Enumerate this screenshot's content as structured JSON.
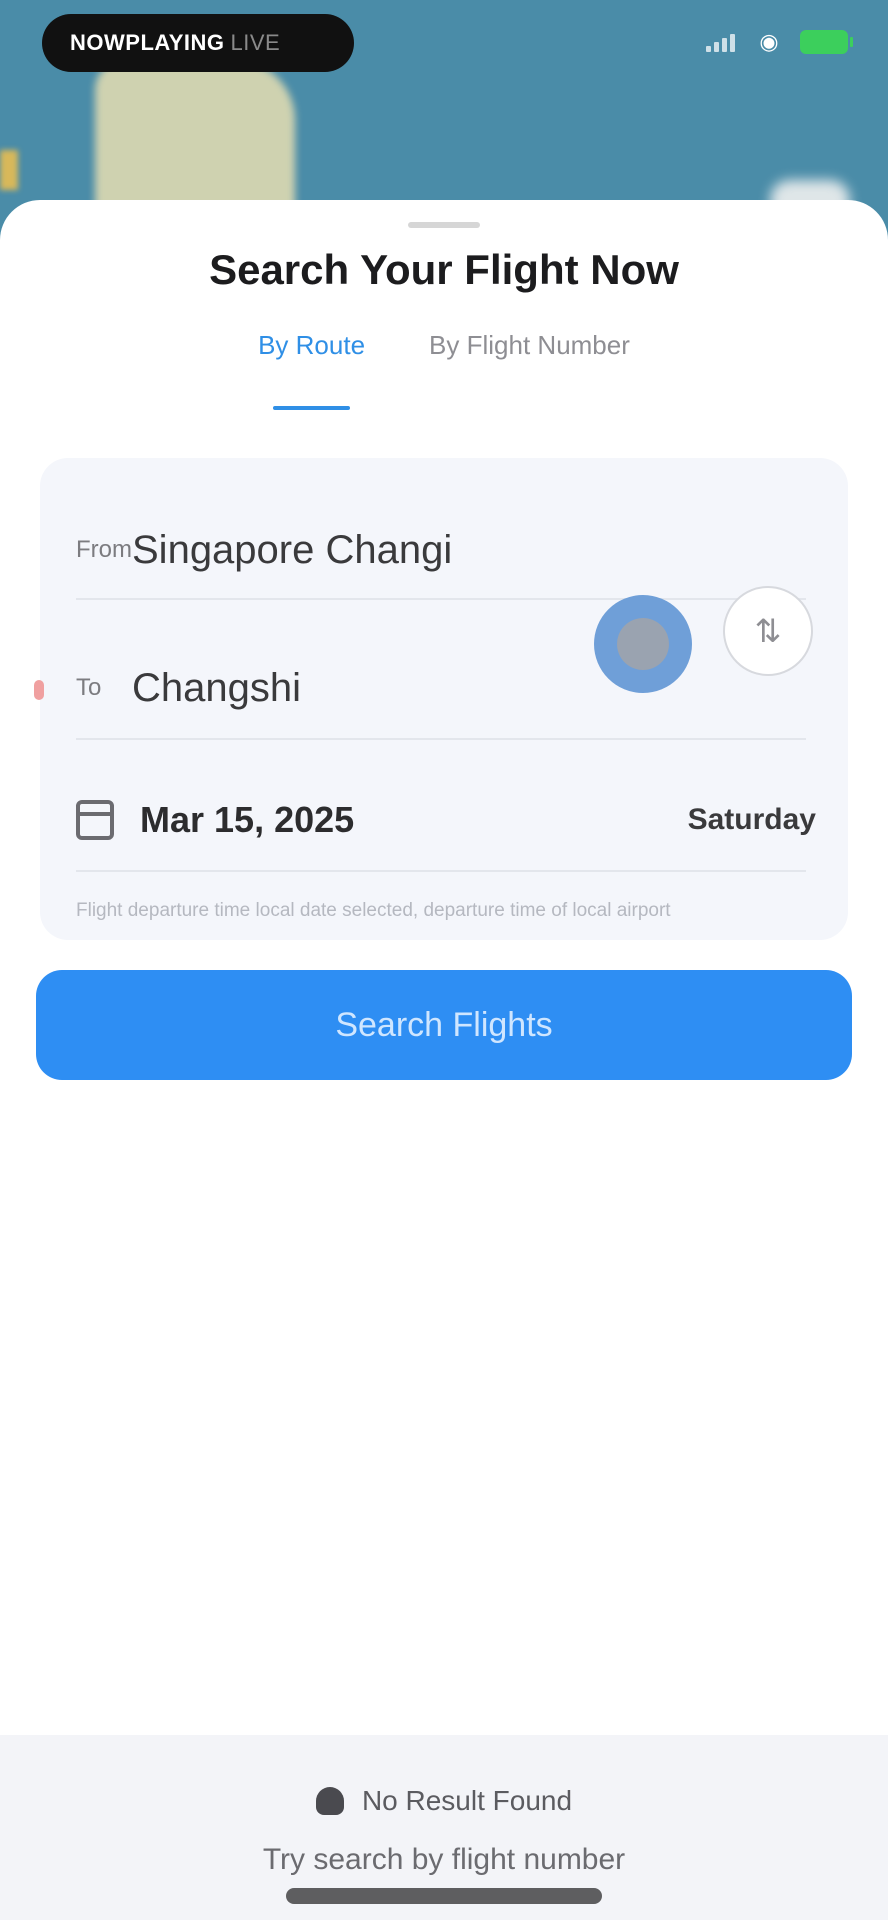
{
  "status_bar": {
    "pill_text": "NOWPLAYING",
    "pill_subtext": "LIVE"
  },
  "sheet": {
    "title": "Search Your Flight Now",
    "tabs": [
      {
        "label": "By Route",
        "active": true
      },
      {
        "label": "By Flight Number",
        "active": false
      }
    ],
    "form": {
      "from_code": "From",
      "from_value": "Singapore Changi",
      "to_code": "To",
      "to_value": "Changshi",
      "date_value": "Mar 15, 2025",
      "day_value": "Saturday",
      "hint": "Flight departure time local date selected, departure time of local airport"
    },
    "search_button": "Search Flights"
  },
  "footer": {
    "line1": "No Result Found",
    "line2": "Try search by flight number"
  },
  "colors": {
    "accent": "#2e8ef3",
    "tab_active": "#2f8fe6",
    "map_water": "#4a8ca8",
    "battery": "#3ccf5c"
  },
  "icons": {
    "swap": "swap-icon",
    "calendar": "calendar-icon",
    "plane": "plane-icon",
    "wifi": "wifi-icon",
    "signal": "signal-icon",
    "battery": "battery-icon"
  }
}
